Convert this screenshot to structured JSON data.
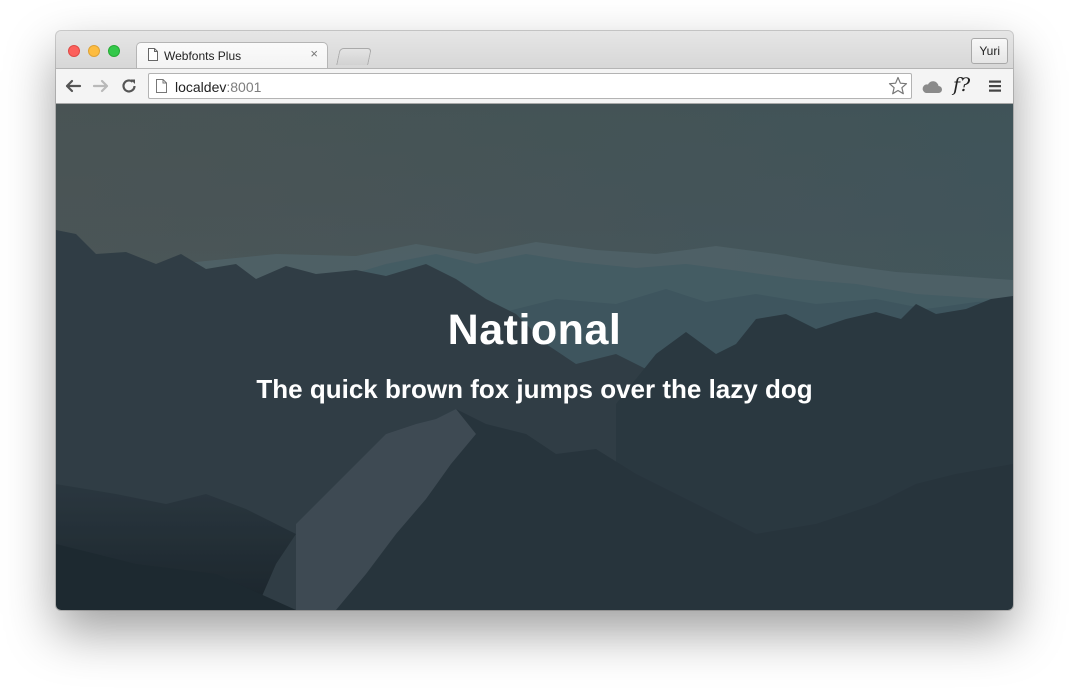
{
  "browser": {
    "tab_title": "Webfonts Plus",
    "tab_close": "×",
    "profile_name": "Yuri",
    "url_host": "localdev",
    "url_port": ":8001",
    "icons": [
      "back-arrow-icon",
      "forward-arrow-icon",
      "reload-icon",
      "page-icon",
      "star-icon",
      "cloud-icon",
      "font-question-icon",
      "menu-icon"
    ],
    "extension_label": "f?"
  },
  "page": {
    "title": "National",
    "subtitle": "The quick brown fox jumps over the lazy dog"
  },
  "colors": {
    "close": "#fc605c",
    "minimize": "#fdbc40",
    "maximize": "#34c84a",
    "text": "#ffffff"
  }
}
